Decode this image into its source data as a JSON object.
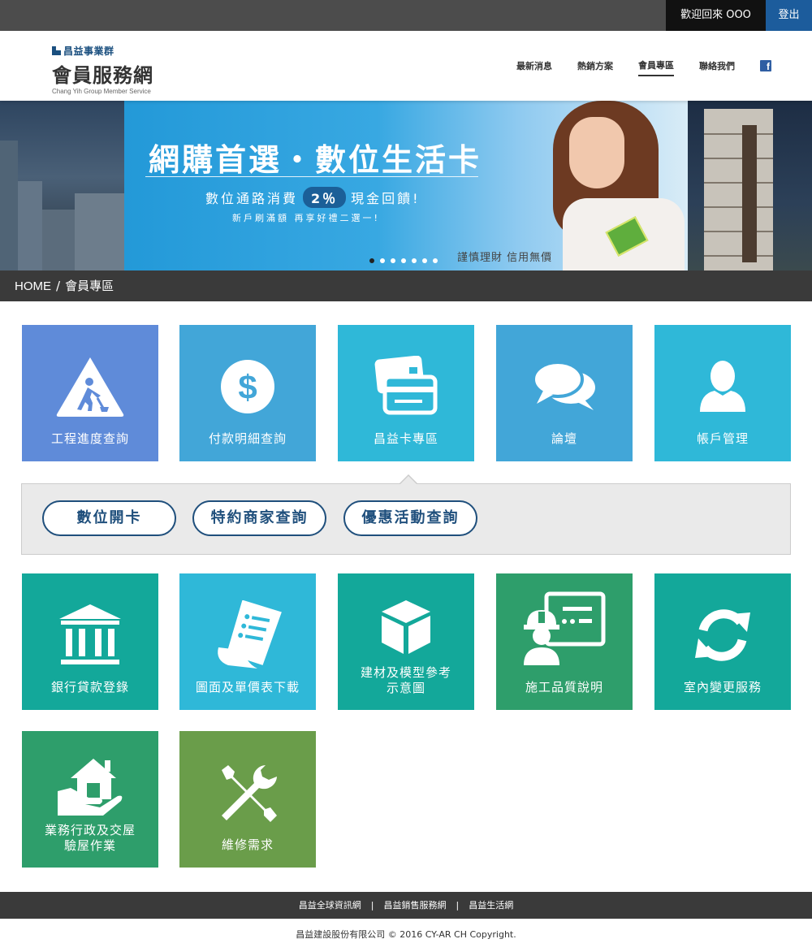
{
  "topbar": {
    "welcome": "歡迎回來 OOO",
    "logout": "登出"
  },
  "logo": {
    "group": "昌益事業群",
    "title": "會員服務網",
    "subtitle": "Chang Yih Group Member Service"
  },
  "nav": {
    "items": [
      "最新消息",
      "熱銷方案",
      "會員專區",
      "聯絡我們"
    ],
    "active_index": 2
  },
  "banner": {
    "title": "網購首選・數位生活卡",
    "subtitle_before": "數位通路消費",
    "percent": "2％",
    "subtitle_after": "現金回饋!",
    "subtitle2": "新戶刷滿額 再享好禮二選一!",
    "footnote": "謹慎理財 信用無價",
    "slides_count": 7,
    "active_slide": 0
  },
  "breadcrumb": {
    "home": "HOME",
    "separator": "/",
    "current": "會員專區"
  },
  "tiles": [
    {
      "label": "工程進度查詢",
      "icon": "construction-sign-icon",
      "color": "#5f8bd9"
    },
    {
      "label": "付款明細查詢",
      "icon": "dollar-icon",
      "color": "#42a6d8"
    },
    {
      "label": "昌益卡專區",
      "icon": "credit-card-icon",
      "color": "#2fb8d8"
    },
    {
      "label": "論壇",
      "icon": "chat-bubbles-icon",
      "color": "#42a6d8"
    },
    {
      "label": "帳戶管理",
      "icon": "user-icon",
      "color": "#2fb8d8"
    },
    {
      "label": "銀行貸款登錄",
      "icon": "bank-icon",
      "color": "#13a89a"
    },
    {
      "label": "圖面及單價表下載",
      "icon": "document-list-icon",
      "color": "#2fb8d8"
    },
    {
      "label_line1": "建材及模型參考",
      "label_line2": "示意圖",
      "icon": "cube-icon",
      "color": "#13a89a"
    },
    {
      "label": "施工品質說明",
      "icon": "worker-board-icon",
      "color": "#2e9e6b"
    },
    {
      "label": "室內變更服務",
      "icon": "refresh-icon",
      "color": "#13a89a"
    },
    {
      "label_line1": "業務行政及交屋",
      "label_line2": "驗屋作業",
      "icon": "house-hand-icon",
      "color": "#2e9e6b"
    },
    {
      "label": "維修需求",
      "icon": "tools-icon",
      "color": "#6a9d4a"
    }
  ],
  "card_submenu": {
    "items": [
      "數位開卡",
      "特約商家查詢",
      "優惠活動查詢"
    ]
  },
  "footer": {
    "links": [
      "昌益全球資訊網",
      "昌益銷售服務網",
      "昌益生活網"
    ],
    "separator": "|",
    "copyright": "昌益建設股份有限公司 © 2016 CY-AR CH Copyright."
  }
}
